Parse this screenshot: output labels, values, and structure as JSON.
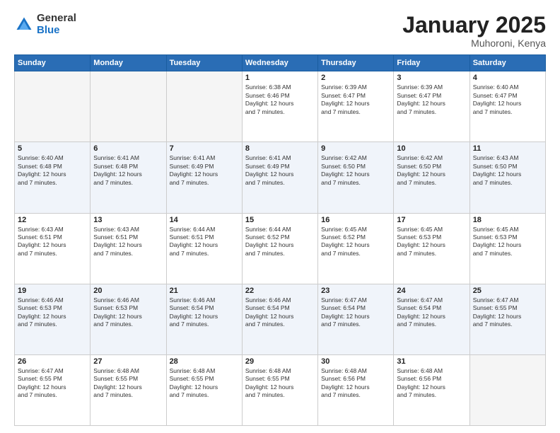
{
  "logo": {
    "general": "General",
    "blue": "Blue"
  },
  "header": {
    "title": "January 2025",
    "subtitle": "Muhoroni, Kenya"
  },
  "days_of_week": [
    "Sunday",
    "Monday",
    "Tuesday",
    "Wednesday",
    "Thursday",
    "Friday",
    "Saturday"
  ],
  "weeks": [
    {
      "shade": false,
      "days": [
        {
          "num": "",
          "info": ""
        },
        {
          "num": "",
          "info": ""
        },
        {
          "num": "",
          "info": ""
        },
        {
          "num": "1",
          "info": "Sunrise: 6:38 AM\nSunset: 6:46 PM\nDaylight: 12 hours\nand 7 minutes."
        },
        {
          "num": "2",
          "info": "Sunrise: 6:39 AM\nSunset: 6:47 PM\nDaylight: 12 hours\nand 7 minutes."
        },
        {
          "num": "3",
          "info": "Sunrise: 6:39 AM\nSunset: 6:47 PM\nDaylight: 12 hours\nand 7 minutes."
        },
        {
          "num": "4",
          "info": "Sunrise: 6:40 AM\nSunset: 6:47 PM\nDaylight: 12 hours\nand 7 minutes."
        }
      ]
    },
    {
      "shade": true,
      "days": [
        {
          "num": "5",
          "info": "Sunrise: 6:40 AM\nSunset: 6:48 PM\nDaylight: 12 hours\nand 7 minutes."
        },
        {
          "num": "6",
          "info": "Sunrise: 6:41 AM\nSunset: 6:48 PM\nDaylight: 12 hours\nand 7 minutes."
        },
        {
          "num": "7",
          "info": "Sunrise: 6:41 AM\nSunset: 6:49 PM\nDaylight: 12 hours\nand 7 minutes."
        },
        {
          "num": "8",
          "info": "Sunrise: 6:41 AM\nSunset: 6:49 PM\nDaylight: 12 hours\nand 7 minutes."
        },
        {
          "num": "9",
          "info": "Sunrise: 6:42 AM\nSunset: 6:50 PM\nDaylight: 12 hours\nand 7 minutes."
        },
        {
          "num": "10",
          "info": "Sunrise: 6:42 AM\nSunset: 6:50 PM\nDaylight: 12 hours\nand 7 minutes."
        },
        {
          "num": "11",
          "info": "Sunrise: 6:43 AM\nSunset: 6:50 PM\nDaylight: 12 hours\nand 7 minutes."
        }
      ]
    },
    {
      "shade": false,
      "days": [
        {
          "num": "12",
          "info": "Sunrise: 6:43 AM\nSunset: 6:51 PM\nDaylight: 12 hours\nand 7 minutes."
        },
        {
          "num": "13",
          "info": "Sunrise: 6:43 AM\nSunset: 6:51 PM\nDaylight: 12 hours\nand 7 minutes."
        },
        {
          "num": "14",
          "info": "Sunrise: 6:44 AM\nSunset: 6:51 PM\nDaylight: 12 hours\nand 7 minutes."
        },
        {
          "num": "15",
          "info": "Sunrise: 6:44 AM\nSunset: 6:52 PM\nDaylight: 12 hours\nand 7 minutes."
        },
        {
          "num": "16",
          "info": "Sunrise: 6:45 AM\nSunset: 6:52 PM\nDaylight: 12 hours\nand 7 minutes."
        },
        {
          "num": "17",
          "info": "Sunrise: 6:45 AM\nSunset: 6:53 PM\nDaylight: 12 hours\nand 7 minutes."
        },
        {
          "num": "18",
          "info": "Sunrise: 6:45 AM\nSunset: 6:53 PM\nDaylight: 12 hours\nand 7 minutes."
        }
      ]
    },
    {
      "shade": true,
      "days": [
        {
          "num": "19",
          "info": "Sunrise: 6:46 AM\nSunset: 6:53 PM\nDaylight: 12 hours\nand 7 minutes."
        },
        {
          "num": "20",
          "info": "Sunrise: 6:46 AM\nSunset: 6:53 PM\nDaylight: 12 hours\nand 7 minutes."
        },
        {
          "num": "21",
          "info": "Sunrise: 6:46 AM\nSunset: 6:54 PM\nDaylight: 12 hours\nand 7 minutes."
        },
        {
          "num": "22",
          "info": "Sunrise: 6:46 AM\nSunset: 6:54 PM\nDaylight: 12 hours\nand 7 minutes."
        },
        {
          "num": "23",
          "info": "Sunrise: 6:47 AM\nSunset: 6:54 PM\nDaylight: 12 hours\nand 7 minutes."
        },
        {
          "num": "24",
          "info": "Sunrise: 6:47 AM\nSunset: 6:54 PM\nDaylight: 12 hours\nand 7 minutes."
        },
        {
          "num": "25",
          "info": "Sunrise: 6:47 AM\nSunset: 6:55 PM\nDaylight: 12 hours\nand 7 minutes."
        }
      ]
    },
    {
      "shade": false,
      "days": [
        {
          "num": "26",
          "info": "Sunrise: 6:47 AM\nSunset: 6:55 PM\nDaylight: 12 hours\nand 7 minutes."
        },
        {
          "num": "27",
          "info": "Sunrise: 6:48 AM\nSunset: 6:55 PM\nDaylight: 12 hours\nand 7 minutes."
        },
        {
          "num": "28",
          "info": "Sunrise: 6:48 AM\nSunset: 6:55 PM\nDaylight: 12 hours\nand 7 minutes."
        },
        {
          "num": "29",
          "info": "Sunrise: 6:48 AM\nSunset: 6:55 PM\nDaylight: 12 hours\nand 7 minutes."
        },
        {
          "num": "30",
          "info": "Sunrise: 6:48 AM\nSunset: 6:56 PM\nDaylight: 12 hours\nand 7 minutes."
        },
        {
          "num": "31",
          "info": "Sunrise: 6:48 AM\nSunset: 6:56 PM\nDaylight: 12 hours\nand 7 minutes."
        },
        {
          "num": "",
          "info": ""
        }
      ]
    }
  ]
}
